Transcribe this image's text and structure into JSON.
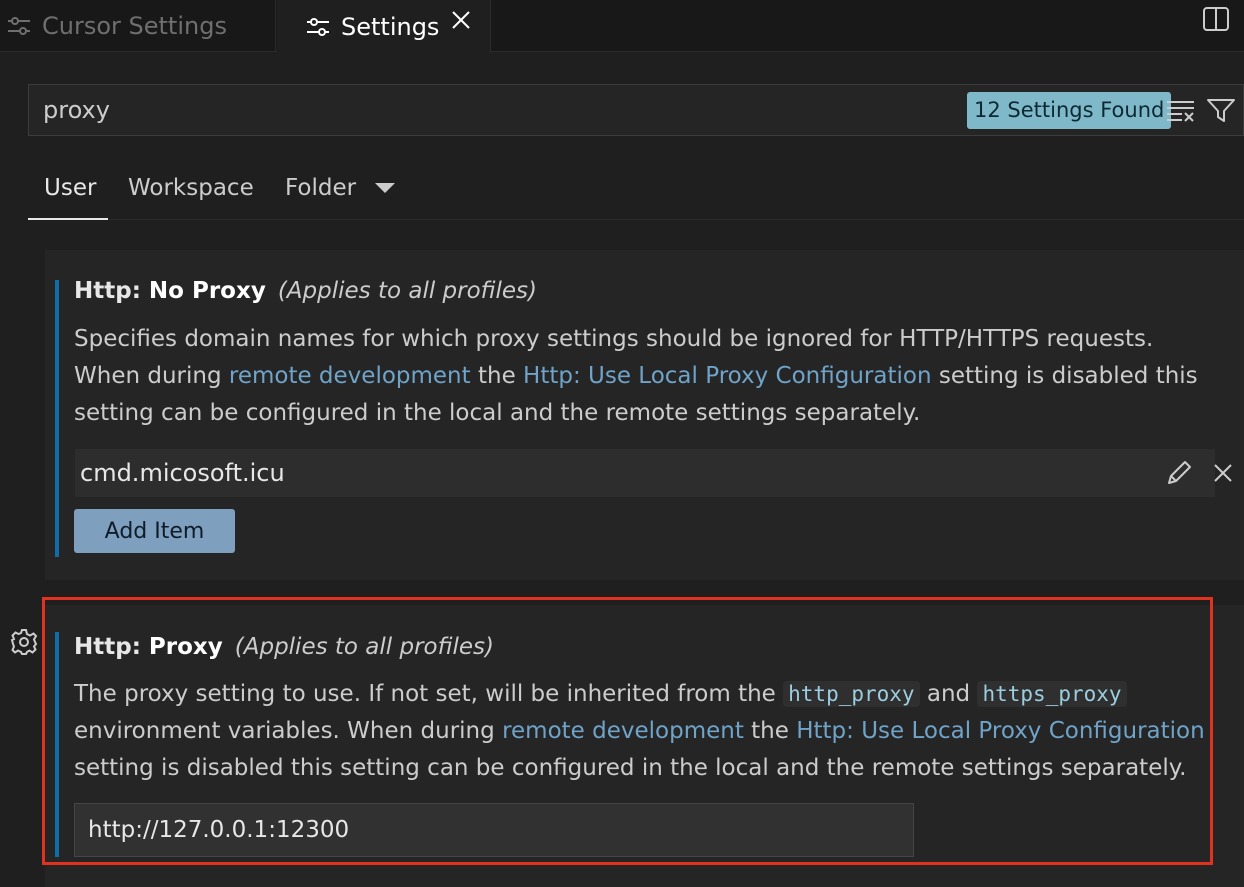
{
  "tabs": [
    {
      "label": "Cursor Settings",
      "active": false
    },
    {
      "label": "Settings",
      "active": true
    }
  ],
  "search": {
    "value": "proxy",
    "results_badge": "12 Settings Found"
  },
  "scope_tabs": [
    "User",
    "Workspace",
    "Folder"
  ],
  "settings": [
    {
      "category": "Http: ",
      "name": "No Proxy",
      "scope_note": "(Applies to all profiles)",
      "desc_line1": "Specifies domain names for which proxy settings should be ignored for HTTP/HTTPS requests.",
      "desc_pre": "When during ",
      "link1": "remote development",
      "desc_mid": " the ",
      "link2": "Http: Use Local Proxy Configuration",
      "desc_post": " setting is disabled this",
      "desc_line3": "setting can be configured in the local and the remote settings separately.",
      "items": [
        "cmd.micosoft.icu"
      ],
      "add_button": "Add Item"
    },
    {
      "category": "Http: ",
      "name": "Proxy",
      "scope_note": "(Applies to all profiles)",
      "desc_a": "The proxy setting to use. If not set, will be inherited from the ",
      "code1": "http_proxy",
      "desc_and": " and ",
      "code2": "https_proxy",
      "desc_b": "environment variables. When during ",
      "link1": "remote development",
      "desc_mid": " the ",
      "link2": "Http: Use Local Proxy Configuration",
      "desc_c": "setting is disabled this setting can be configured in the local and the remote settings separately.",
      "value": "http://127.0.0.1:12300"
    }
  ],
  "colors": {
    "accent_bar": "#0e6fa8",
    "badge": "#7fb8c9",
    "link": "#6fa3c8",
    "highlight_border": "#e0321e",
    "button": "#7f9fbf"
  },
  "icons": [
    "settings-sliders-icon",
    "close-icon",
    "split-editor-icon",
    "clear-filter-icon",
    "filter-icon",
    "chevron-down-icon",
    "edit-icon",
    "remove-icon",
    "gear-icon"
  ]
}
